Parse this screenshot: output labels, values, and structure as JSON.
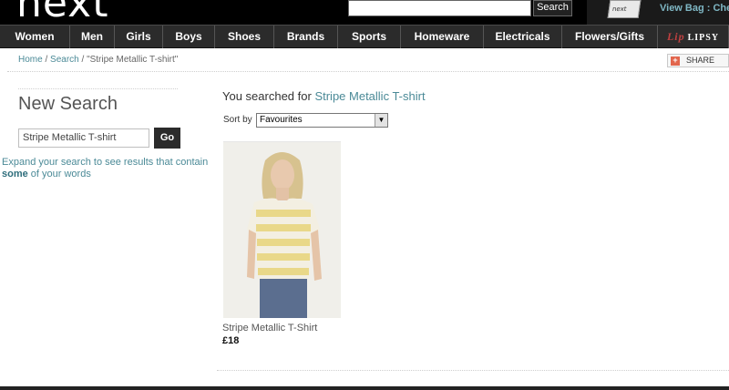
{
  "header": {
    "logo": "next",
    "search_placeholder": "",
    "search_button": "Search",
    "bag_icon_text": "next",
    "view_bag": "View Bag : Che"
  },
  "nav": {
    "items": [
      {
        "label": "Women",
        "lipsy": false
      },
      {
        "label": "Men",
        "lipsy": false
      },
      {
        "label": "Girls",
        "lipsy": false
      },
      {
        "label": "Boys",
        "lipsy": false
      },
      {
        "label": "Shoes",
        "lipsy": false
      },
      {
        "label": "Brands",
        "lipsy": false
      },
      {
        "label": "Sports",
        "lipsy": false
      },
      {
        "label": "Homeware",
        "lipsy": false
      },
      {
        "label": "Electricals",
        "lipsy": false
      },
      {
        "label": "Flowers/Gifts",
        "lipsy": false
      },
      {
        "label": "LIPSY",
        "lipsy": true
      }
    ]
  },
  "breadcrumb": {
    "home": "Home",
    "sep1": " / ",
    "search": "Search",
    "sep2": " / ",
    "current": "\"Stripe Metallic T-shirt\""
  },
  "share": {
    "icon": "+",
    "label": "SHARE"
  },
  "sidebar": {
    "title": "New Search",
    "input_value": "Stripe Metallic T-shirt",
    "go_label": "Go",
    "help_prefix": "Expand your search to see results that contain ",
    "help_bold": "some",
    "help_suffix": " of your words"
  },
  "results": {
    "searched_prefix": "You searched for ",
    "searched_term": "Stripe Metallic T-shirt",
    "sort_label": "Sort by",
    "sort_value": "Favourites",
    "products": [
      {
        "name": "Stripe Metallic T-Shirt",
        "price": "£18"
      }
    ]
  }
}
